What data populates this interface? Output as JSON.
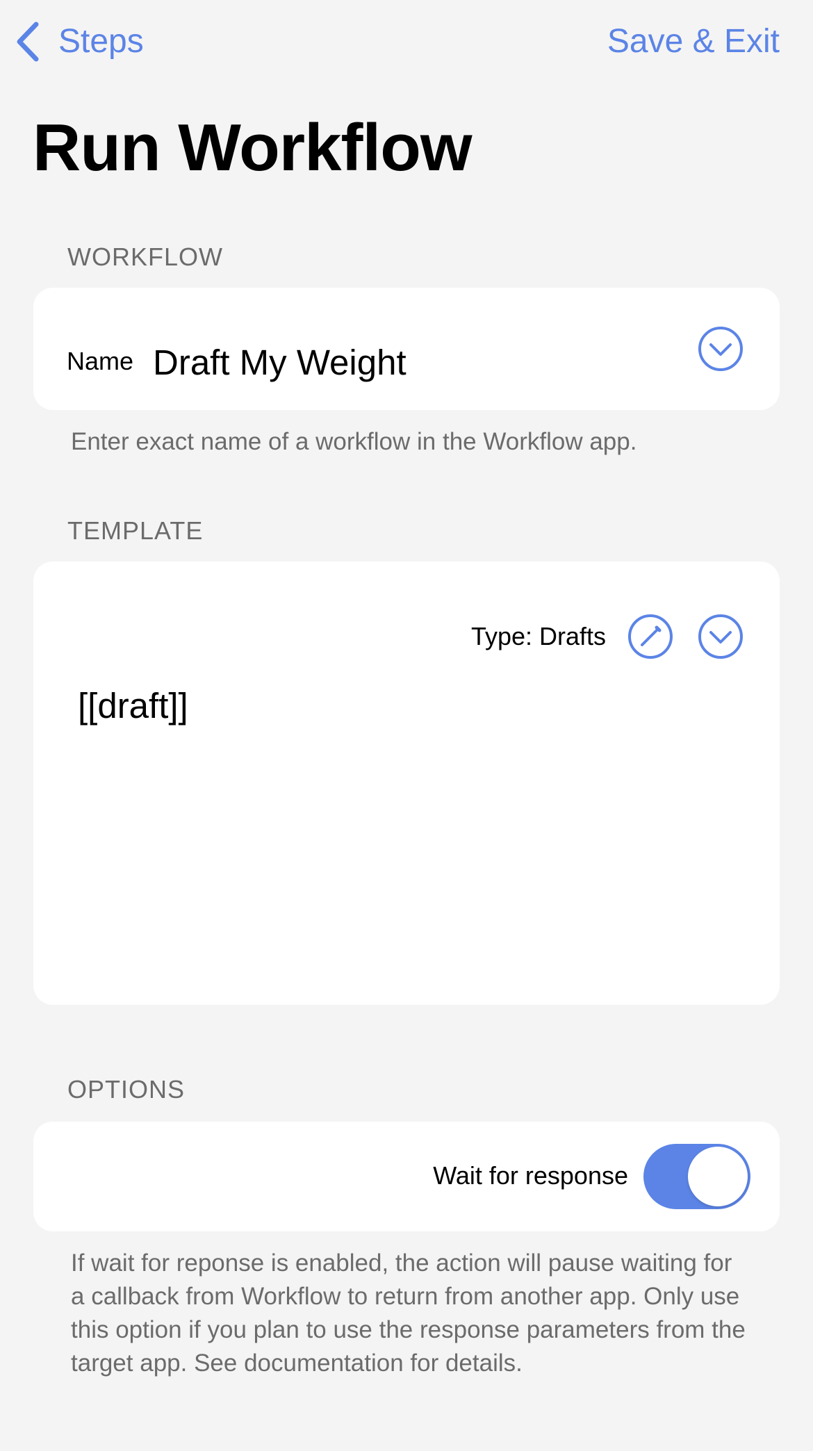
{
  "nav": {
    "back_label": "Steps",
    "save_label": "Save & Exit"
  },
  "title": "Run Workflow",
  "workflow_section": {
    "header": "WORKFLOW",
    "name_label": "Name",
    "name_value": "Draft My Weight",
    "footer": "Enter exact name of a workflow in the Workflow app."
  },
  "template_section": {
    "header": "TEMPLATE",
    "type_label": "Type: Drafts",
    "content": "[[draft]]"
  },
  "options_section": {
    "header": "OPTIONS",
    "wait_label": "Wait for response",
    "wait_enabled": true,
    "footer": "If wait for reponse is enabled, the action will pause waiting for a callback from Workflow to return from another app. Only use this option if you plan to use the response parameters from the target app. See documentation for details."
  },
  "icons": {
    "back": "chevron-left-icon",
    "dropdown": "chevron-down-circle-icon",
    "edit": "pencil-circle-icon"
  },
  "colors": {
    "accent": "#5b84e6",
    "background": "#f4f4f4",
    "card": "#ffffff",
    "secondary_text": "#6b6b6b"
  }
}
